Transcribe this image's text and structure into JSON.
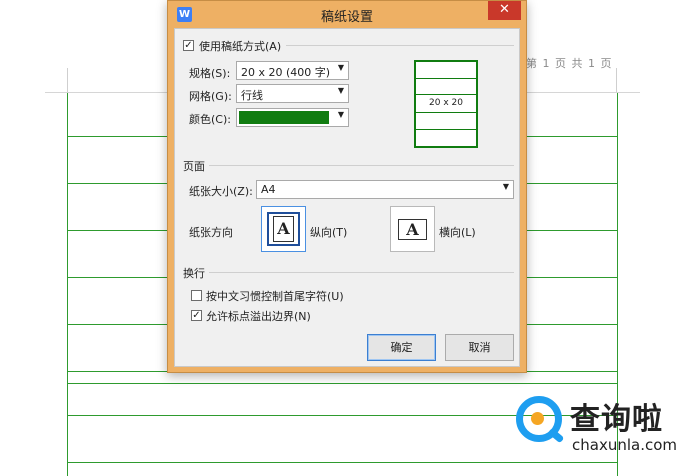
{
  "document": {
    "page_indicator": "第 1 页 共 1 页"
  },
  "dialog": {
    "title": "稿纸设置",
    "close_glyph": "✕",
    "app_icon_glyph": "W",
    "use_grid_paper": {
      "label": "使用稿纸方式(A)",
      "checked": true
    },
    "spec": {
      "label": "规格(S):",
      "value": "20 x 20 (400 字)"
    },
    "grid": {
      "label": "网格(G):",
      "value": "行线"
    },
    "color": {
      "label": "颜色(C):",
      "value_hex": "#107c10"
    },
    "preview": {
      "label": "20 x 20"
    },
    "page_section": {
      "title": "页面",
      "paper_size": {
        "label": "纸张大小(Z):",
        "value": "A4"
      },
      "orientation": {
        "label": "纸张方向",
        "portrait": {
          "label": "纵向(T)",
          "glyph": "A",
          "selected": true
        },
        "landscape": {
          "label": "横向(L)",
          "glyph": "A",
          "selected": false
        }
      }
    },
    "wrap_section": {
      "title": "换行",
      "options": [
        {
          "label": "按中文习惯控制首尾字符(U)",
          "checked": false
        },
        {
          "label": "允许标点溢出边界(N)",
          "checked": true
        }
      ]
    },
    "buttons": {
      "ok": "确定",
      "cancel": "取消"
    }
  },
  "watermark": {
    "text": "查询啦",
    "domain": "chaxunla.com"
  },
  "colors": {
    "dialog_frame": "#eeb064",
    "close_button": "#c9382a",
    "grid_green": "#107c10",
    "doc_grid": "#2e9b2e",
    "watermark_blue": "#1e9ef0",
    "watermark_orange": "#f5a623"
  }
}
